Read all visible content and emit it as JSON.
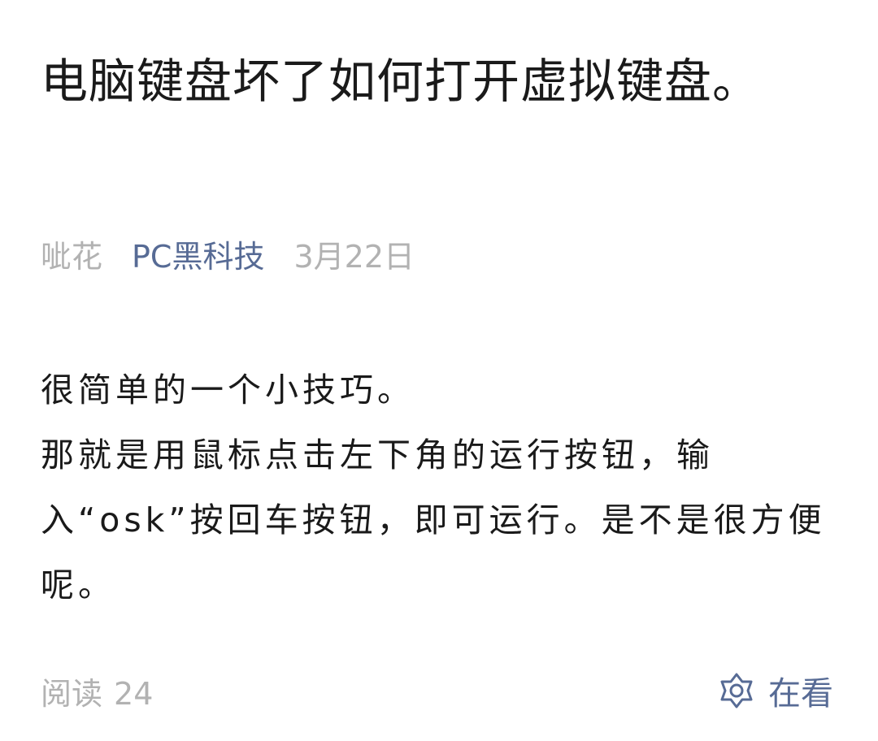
{
  "article": {
    "title": "电脑键盘坏了如何打开虚拟键盘。",
    "author": "呲花",
    "account": "PC黑科技",
    "date": "3月22日",
    "paragraphs": [
      "很简单的一个小技巧。",
      "那就是用鼠标点击左下角的运行按钮，输入“osk”按回车按钮，即可运行。是不是很方便呢。"
    ]
  },
  "footer": {
    "read_label": "阅读",
    "read_count": "24",
    "watch_label": "在看",
    "watch_icon": "wow-star-icon"
  },
  "colors": {
    "link": "#576b95",
    "muted": "#b2b2b2",
    "text": "#1a1a1a"
  }
}
